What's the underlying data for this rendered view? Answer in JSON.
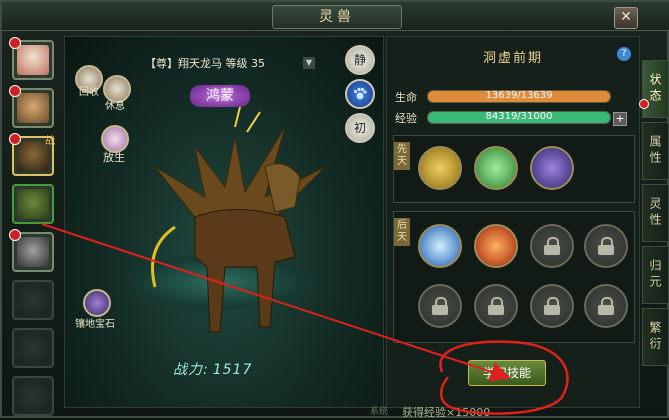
{
  "window": {
    "title": "灵兽",
    "close_glyph": "✕"
  },
  "pet_list": {
    "battle_tag": "战",
    "slots": [
      "pet-monkey",
      "pet-tiger",
      "pet-dragon-horse",
      "pet-serpent",
      "pet-wolf",
      "empty",
      "empty",
      "empty"
    ]
  },
  "stage": {
    "pet_name": "【尊】翔天龙马 等级 35",
    "rank_badge": "鸿蒙",
    "buttons": {
      "rest": "静",
      "paw": "paw-icon",
      "train": "初"
    },
    "actions": [
      {
        "label": "回收",
        "icon": "recall-icon"
      },
      {
        "label": "休息",
        "icon": "rest-icon"
      },
      {
        "label": "放生",
        "icon": "release-icon"
      },
      {
        "label": "镶地宝石",
        "icon": "gem-icon"
      }
    ],
    "power_label": "战力:",
    "power_value": "1517"
  },
  "panel": {
    "realm": "洞虚前期",
    "help": "?",
    "hp_label": "生命",
    "hp_text": "13639/13639",
    "hp_fraction": 1.0,
    "exp_label": "经验",
    "exp_text": "84319/31000",
    "exp_fraction": 1.0,
    "plus": "+",
    "innate_tag": "先天",
    "acquired_tag": "后天",
    "innate_skills": [
      "golden-sword-skill",
      "green-meditation-skill",
      "purple-bird-skill"
    ],
    "acquired_skills": [
      "blue-swirl-skill",
      "fire-slash-skill",
      "locked",
      "locked",
      "locked",
      "locked",
      "locked",
      "locked"
    ]
  },
  "learn_button": "学习技能",
  "tabs": [
    {
      "label": "状态",
      "active": true,
      "dot": true
    },
    {
      "label": "属性",
      "active": false,
      "dot": false
    },
    {
      "label": "灵性",
      "active": false,
      "dot": false
    },
    {
      "label": "归元",
      "active": false,
      "dot": false
    },
    {
      "label": "繁衍",
      "active": false,
      "dot": false
    }
  ],
  "bottom_message": "获得经验×15000",
  "bottom_prefix": "系统",
  "colors": {
    "hp_fill": "#e08a3a",
    "exp_fill": "#3ab878",
    "annotation": "#e0201a"
  }
}
